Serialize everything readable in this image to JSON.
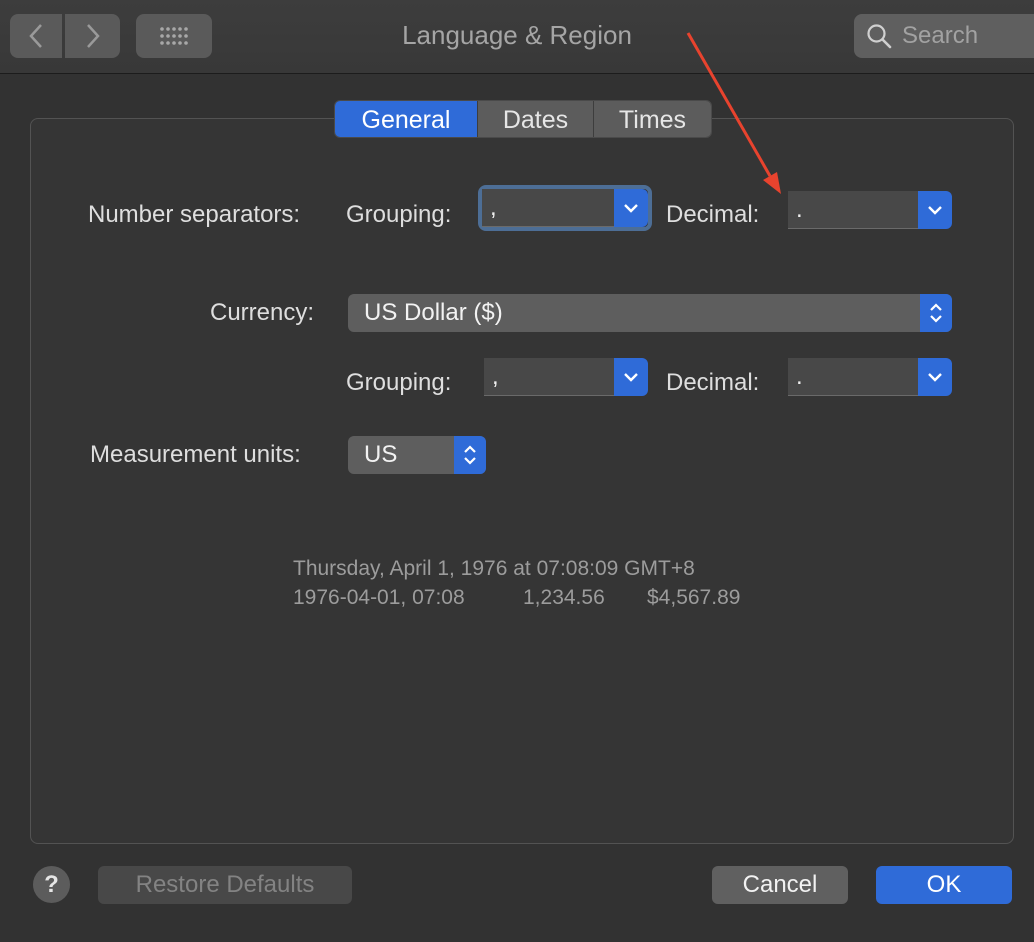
{
  "window": {
    "title": "Language & Region"
  },
  "toolbar": {
    "search_placeholder": "Search"
  },
  "tabs": [
    {
      "label": "General",
      "active": true
    },
    {
      "label": "Dates",
      "active": false
    },
    {
      "label": "Times",
      "active": false
    }
  ],
  "number_separators": {
    "label": "Number separators:",
    "grouping_label": "Grouping:",
    "grouping_value": ",",
    "decimal_label": "Decimal:",
    "decimal_value": "."
  },
  "currency": {
    "label": "Currency:",
    "value": "US Dollar ($)",
    "grouping_label": "Grouping:",
    "grouping_value": ",",
    "decimal_label": "Decimal:",
    "decimal_value": "."
  },
  "measurement": {
    "label": "Measurement units:",
    "value": "US"
  },
  "sample": {
    "line1": "Thursday, April 1, 1976 at 07:08:09 GMT+8",
    "date_time": "1976-04-01, 07:08",
    "number": "1,234.56",
    "currency": "$4,567.89"
  },
  "footer": {
    "help": "?",
    "restore_defaults": "Restore Defaults",
    "cancel": "Cancel",
    "ok": "OK"
  },
  "colors": {
    "accent": "#2f6bd8",
    "annotation_arrow": "#e8432e"
  }
}
